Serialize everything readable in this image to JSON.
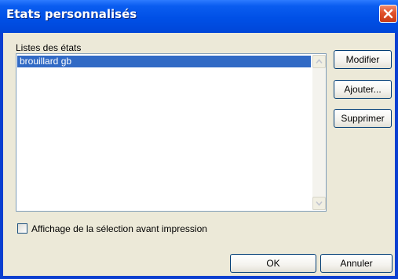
{
  "window": {
    "title": "Etats personnalisés"
  },
  "list": {
    "label": "Listes des états",
    "items": [
      "brouillard gb"
    ],
    "selected_index": 0
  },
  "side_buttons": {
    "modifier": "Modifier",
    "ajouter": "Ajouter...",
    "supprimer": "Supprimer"
  },
  "preview_option": {
    "label": "Affichage de la sélection avant impression",
    "checked": false
  },
  "footer": {
    "ok": "OK",
    "cancel": "Annuler"
  },
  "colors": {
    "titlebar": "#0050e6",
    "selection": "#316ac5",
    "close_button": "#e0512c",
    "dialog_face": "#ece9d8"
  },
  "icons": {
    "close": "close-icon",
    "scroll_up": "scroll-up-arrow-icon",
    "scroll_down": "scroll-down-arrow-icon"
  }
}
